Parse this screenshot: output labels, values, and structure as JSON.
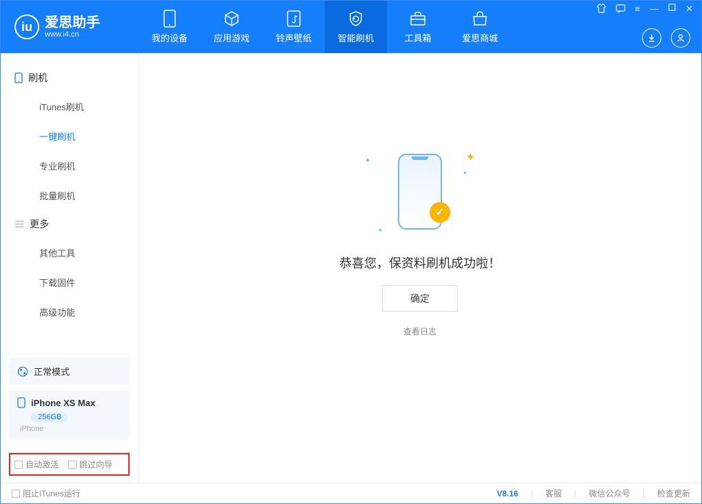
{
  "app": {
    "title": "爱思助手",
    "subtitle": "www.i4.cn"
  },
  "nav": {
    "my_device": "我的设备",
    "apps_games": "应用游戏",
    "ringtones": "铃声壁纸",
    "smart_flash": "智能刷机",
    "toolbox": "工具箱",
    "store": "爱思商城"
  },
  "sidebar": {
    "group_flash": "刷机",
    "items_flash": {
      "itunes": "iTunes刷机",
      "one_click": "一键刷机",
      "pro": "专业刷机",
      "batch": "批量刷机"
    },
    "group_more": "更多",
    "items_more": {
      "other_tools": "其他工具",
      "download_fw": "下载固件",
      "advanced": "高级功能"
    },
    "mode_card": "正常模式",
    "device_name": "iPhone XS Max",
    "device_capacity": "256GB",
    "device_type": "iPhone",
    "checkbox_auto_activate": "自动激活",
    "checkbox_skip_guide": "跳过向导"
  },
  "main": {
    "success_text": "恭喜您，保资料刷机成功啦！",
    "ok_button": "确定",
    "view_log": "查看日志"
  },
  "footer": {
    "block_itunes": "阻止iTunes运行",
    "version": "V8.16",
    "support": "客服",
    "wechat": "微信公众号",
    "check_update": "检查更新"
  }
}
